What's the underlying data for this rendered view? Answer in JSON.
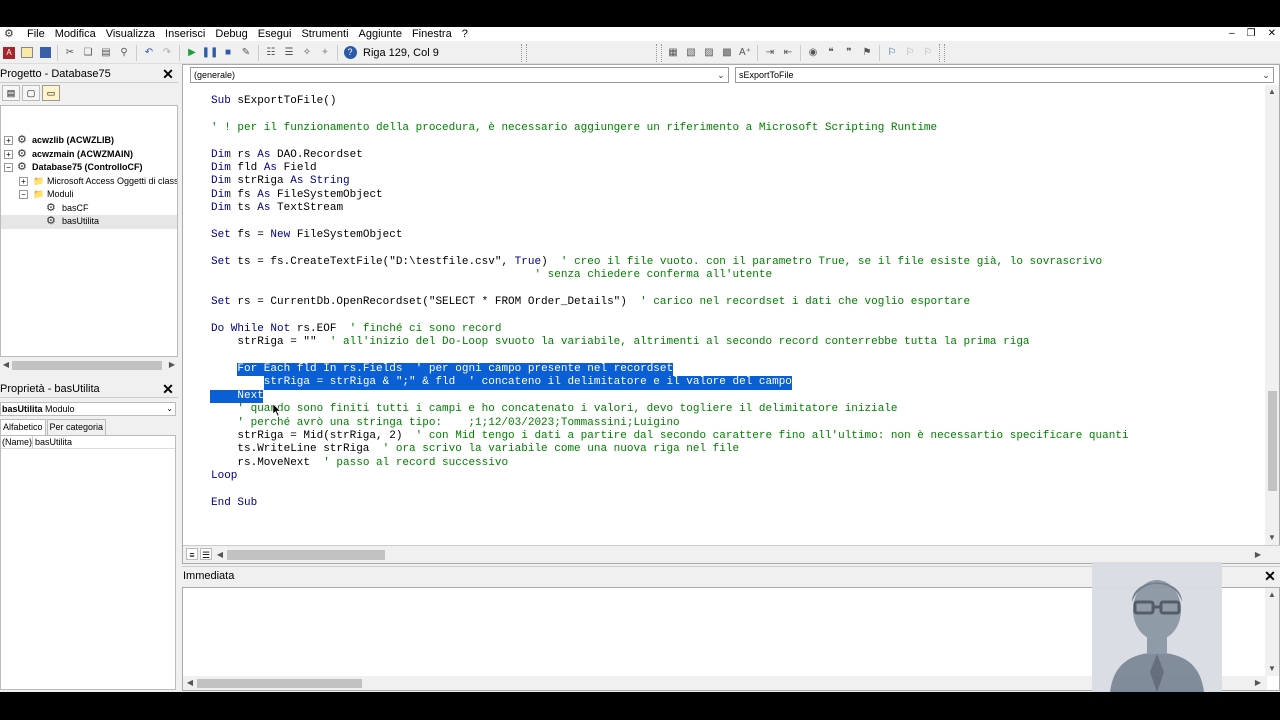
{
  "menubar": {
    "items": [
      "File",
      "Modifica",
      "Visualizza",
      "Inserisci",
      "Debug",
      "Esegui",
      "Strumenti",
      "Aggiunte",
      "Finestra",
      "?"
    ]
  },
  "toolbar": {
    "position_text": "Riga 129, Col 9"
  },
  "project_panel": {
    "title": "Progetto - Database75",
    "tree": [
      {
        "label": "acwzlib (ACWZLIB)",
        "bold": true
      },
      {
        "label": "acwzmain (ACWZMAIN)",
        "bold": true
      },
      {
        "label": "Database75 (ControlloCF)",
        "bold": true
      },
      {
        "label": "Microsoft Access Oggetti di classe",
        "bold": false
      },
      {
        "label": "Moduli",
        "bold": false
      },
      {
        "label": "basCF",
        "bold": false
      },
      {
        "label": "basUtilita",
        "bold": false
      }
    ]
  },
  "properties_panel": {
    "title": "Proprietà - basUtilita",
    "object_name": "basUtilita",
    "object_type": "Modulo",
    "tabs": [
      "Alfabetico",
      "Per categoria"
    ],
    "rows": [
      {
        "key": "(Name)",
        "value": "basUtilita"
      }
    ]
  },
  "code_window": {
    "object_combo": "(generale)",
    "procedure_combo": "sExportToFile",
    "lines": [
      {
        "row": 0,
        "indent": 0,
        "parts": [
          {
            "t": "kw",
            "s": "Sub "
          },
          {
            "t": "tx",
            "s": "sExportToFile()"
          }
        ]
      },
      {
        "row": 2,
        "indent": 0,
        "parts": [
          {
            "t": "cm",
            "s": "' ! per il funzionamento della procedura, è necessario aggiungere un riferimento a Microsoft Scripting Runtime"
          }
        ]
      },
      {
        "row": 4,
        "indent": 0,
        "parts": [
          {
            "t": "kw",
            "s": "Dim "
          },
          {
            "t": "tx",
            "s": "rs "
          },
          {
            "t": "kw",
            "s": "As "
          },
          {
            "t": "tx",
            "s": "DAO.Recordset"
          }
        ]
      },
      {
        "row": 5,
        "indent": 0,
        "parts": [
          {
            "t": "kw",
            "s": "Dim "
          },
          {
            "t": "tx",
            "s": "fld "
          },
          {
            "t": "kw",
            "s": "As "
          },
          {
            "t": "tx",
            "s": "Field"
          }
        ]
      },
      {
        "row": 6,
        "indent": 0,
        "parts": [
          {
            "t": "kw",
            "s": "Dim "
          },
          {
            "t": "tx",
            "s": "strRiga "
          },
          {
            "t": "kw",
            "s": "As String"
          }
        ]
      },
      {
        "row": 7,
        "indent": 0,
        "parts": [
          {
            "t": "kw",
            "s": "Dim "
          },
          {
            "t": "tx",
            "s": "fs "
          },
          {
            "t": "kw",
            "s": "As "
          },
          {
            "t": "tx",
            "s": "FileSystemObject"
          }
        ]
      },
      {
        "row": 8,
        "indent": 0,
        "parts": [
          {
            "t": "kw",
            "s": "Dim "
          },
          {
            "t": "tx",
            "s": "ts "
          },
          {
            "t": "kw",
            "s": "As "
          },
          {
            "t": "tx",
            "s": "TextStream"
          }
        ]
      },
      {
        "row": 10,
        "indent": 0,
        "parts": [
          {
            "t": "kw",
            "s": "Set "
          },
          {
            "t": "tx",
            "s": "fs = "
          },
          {
            "t": "kw",
            "s": "New "
          },
          {
            "t": "tx",
            "s": "FileSystemObject"
          }
        ]
      },
      {
        "row": 12,
        "indent": 0,
        "parts": [
          {
            "t": "kw",
            "s": "Set "
          },
          {
            "t": "tx",
            "s": "ts = fs.CreateTextFile(\"D:\\testfile.csv\", "
          },
          {
            "t": "kw",
            "s": "True"
          },
          {
            "t": "tx",
            "s": ")  "
          },
          {
            "t": "cm",
            "s": "' creo il file vuoto. con il parametro True, se il file esiste già, lo sovrascrivo"
          }
        ]
      },
      {
        "row": 13,
        "indent": 0,
        "parts": [
          {
            "t": "tx",
            "s": "                                                 "
          },
          {
            "t": "cm",
            "s": "' senza chiedere conferma all'utente"
          }
        ]
      },
      {
        "row": 15,
        "indent": 0,
        "parts": [
          {
            "t": "kw",
            "s": "Set "
          },
          {
            "t": "tx",
            "s": "rs = CurrentDb.OpenRecordset(\"SELECT * FROM Order_Details\")  "
          },
          {
            "t": "cm",
            "s": "' carico nel recordset i dati che voglio esportare"
          }
        ]
      },
      {
        "row": 17,
        "indent": 0,
        "parts": [
          {
            "t": "kw",
            "s": "Do While Not "
          },
          {
            "t": "tx",
            "s": "rs.EOF  "
          },
          {
            "t": "cm",
            "s": "' finché ci sono record"
          }
        ]
      },
      {
        "row": 18,
        "indent": 4,
        "parts": [
          {
            "t": "tx",
            "s": "strRiga = \"\"  "
          },
          {
            "t": "cm",
            "s": "' all'inizio del Do-Loop svuoto la variabile, altrimenti al secondo record conterrebbe tutta la prima riga"
          }
        ]
      },
      {
        "row": 20,
        "indent": 4,
        "sel": true,
        "parts": [
          {
            "t": "kw",
            "s": "For Each "
          },
          {
            "t": "tx",
            "s": "fld "
          },
          {
            "t": "kw",
            "s": "In "
          },
          {
            "t": "tx",
            "s": "rs.Fields  "
          },
          {
            "t": "cm",
            "s": "' per ogni campo presente nel recordset"
          }
        ]
      },
      {
        "row": 21,
        "indent": 8,
        "sel": true,
        "parts": [
          {
            "t": "tx",
            "s": "strRiga = strRiga & \";\" & fld  "
          },
          {
            "t": "cm",
            "s": "' concateno il delimitatore e il valore del campo"
          }
        ]
      },
      {
        "row": 22,
        "indent": 4,
        "sel": true,
        "parts": [
          {
            "t": "kw",
            "s": "Next"
          }
        ]
      },
      {
        "row": 23,
        "indent": 4,
        "parts": [
          {
            "t": "cm",
            "s": "' quando sono finiti tutti i campi e ho concatenato i valori, devo togliere il delimitatore iniziale"
          }
        ]
      },
      {
        "row": 24,
        "indent": 4,
        "parts": [
          {
            "t": "cm",
            "s": "' perché avrò una stringa tipo:    ;1;12/03/2023;Tommassini;Luigino"
          }
        ]
      },
      {
        "row": 25,
        "indent": 4,
        "parts": [
          {
            "t": "tx",
            "s": "strRiga = Mid(strRiga, 2)  "
          },
          {
            "t": "cm",
            "s": "' con Mid tengo i dati a partire dal secondo carattere fino all'ultimo: non è necessartio specificare quanti"
          }
        ]
      },
      {
        "row": 26,
        "indent": 4,
        "parts": [
          {
            "t": "tx",
            "s": "ts.WriteLine strRiga  "
          },
          {
            "t": "cm",
            "s": "' ora scrivo la variabile come una nuova riga nel file"
          }
        ]
      },
      {
        "row": 27,
        "indent": 4,
        "parts": [
          {
            "t": "tx",
            "s": "rs.MoveNext  "
          },
          {
            "t": "cm",
            "s": "' passo al record successivo"
          }
        ]
      },
      {
        "row": 28,
        "indent": 0,
        "parts": [
          {
            "t": "kw",
            "s": "Loop"
          }
        ]
      },
      {
        "row": 30,
        "indent": 0,
        "parts": [
          {
            "t": "kw",
            "s": "End Sub"
          }
        ]
      }
    ]
  },
  "immediate_window": {
    "title": "Immediata"
  },
  "colors": {
    "keyword": "#00008b",
    "comment": "#008000",
    "selection": "#0a5fd4"
  }
}
